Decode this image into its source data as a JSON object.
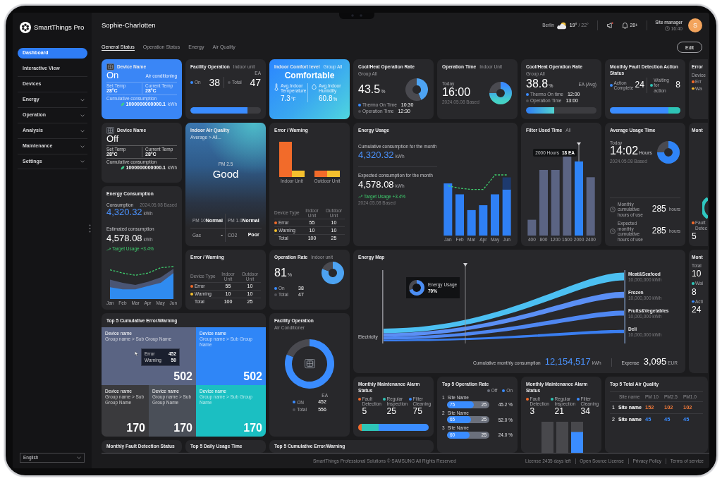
{
  "sidebar": {
    "brand": "SmartThings Pro",
    "items": [
      {
        "label": "Dashboard",
        "selected": true,
        "expandable": false
      },
      {
        "label": "Interactive View",
        "selected": false,
        "expandable": false
      },
      {
        "label": "Devices",
        "selected": false,
        "expandable": false
      },
      {
        "label": "Energy",
        "selected": false,
        "expandable": true
      },
      {
        "label": "Operation",
        "selected": false,
        "expandable": true
      },
      {
        "label": "Analysis",
        "selected": false,
        "expandable": true
      },
      {
        "label": "Maintenance",
        "selected": false,
        "expandable": true
      },
      {
        "label": "Settings",
        "selected": false,
        "expandable": true
      }
    ],
    "language": "English"
  },
  "header": {
    "title": "Sophie-Charlotten",
    "weather": {
      "city": "Berlin",
      "temperature": "19°",
      "range": "/ 22°"
    },
    "notifications": "28+",
    "user": {
      "role": "Site manager",
      "time": "16:40",
      "initial": "S"
    }
  },
  "tabs": [
    {
      "label": "General Status",
      "selected": true
    },
    {
      "label": "Operation Status",
      "selected": false
    },
    {
      "label": "Energy",
      "selected": false
    },
    {
      "label": "Air Quality",
      "selected": false
    }
  ],
  "edit_button": "Edit",
  "cards": [
    {
      "kind": "device",
      "on": true,
      "title": "Device Name",
      "power": "On",
      "mode": "Air conditioning",
      "stats": [
        {
          "label": "Set Temp",
          "value": "28°C"
        },
        {
          "label": "Current Temp",
          "value": "28°C"
        }
      ],
      "consumption_label": "Cumulative consumption",
      "consumption": "1000000000000.1",
      "unit": "kWh"
    },
    {
      "kind": "facility_bar",
      "title": "Facility Operation",
      "subtitle": "Indoor unit",
      "unit": "EA",
      "items": [
        {
          "label": "On",
          "value": "38",
          "color": "#3a8cff"
        },
        {
          "label": "Total",
          "value": "47",
          "color": "#505055"
        }
      ],
      "level": 0.81
    },
    {
      "kind": "comfort",
      "title": "Indoor Comfort level",
      "subtitle": "Group All",
      "status": "Comfortable",
      "metrics": [
        {
          "kind": "temperature",
          "label": "Avg.Indoor Temperature",
          "value": "7.3",
          "unit": "°F"
        },
        {
          "kind": "humidity",
          "label": "Avg.Indoor Humidity",
          "value": "60.8",
          "unit": "%"
        }
      ]
    },
    {
      "kind": "rate_donut",
      "title": "Cool/Heat Operation Rate",
      "subtitle": "Group All",
      "value": "43.5",
      "unit": "%",
      "items": [
        {
          "label": "Thermo On Time",
          "value": "10:30",
          "color": "#3a8cff"
        },
        {
          "label": "Operation Time",
          "value": "12:30",
          "color": "#505055"
        }
      ],
      "chart_data": {
        "type": "donut",
        "values": [
          43.5,
          56.5
        ]
      }
    },
    {
      "kind": "time_donut",
      "title": "Operation Time",
      "subtitle": "Indoor Unit",
      "caption": "Today",
      "value": "16:00",
      "based": "2024.05.08 Based"
    },
    {
      "kind": "rate_bar",
      "title": "Cool/Heat Operation Rate",
      "subtitle": "Group All",
      "note": "EA (Avg)",
      "value": "38.8",
      "unit": "%",
      "items": [
        {
          "label": "Thermo On time",
          "value": "12:00",
          "color": "#3a8cff"
        },
        {
          "label": "Operation Time",
          "value": "13:00",
          "color": "#505055"
        }
      ],
      "level": 0.4
    },
    {
      "kind": "action_status",
      "title": "Monthly Fault Detection Action Status",
      "items": [
        {
          "label": "Action Complete",
          "value": "24",
          "color": "#3a8cff",
          "level": 0.83
        },
        {
          "label": "Waiting for action",
          "value": "8",
          "color": "#2ec4b6",
          "level": 0.17
        }
      ]
    },
    {
      "kind": "clipped",
      "title": "Error",
      "lines": [
        {
          "kind": "label",
          "text": "Device"
        },
        {
          "kind": "label",
          "text": "Err",
          "color": "#f26b2a"
        },
        {
          "kind": "label",
          "text": "Wa",
          "color": "#f5b82e"
        }
      ]
    },
    {
      "kind": "device",
      "on": false,
      "title": "Device Name",
      "power": "Off",
      "stats": [
        {
          "label": "Set Temp",
          "value": "28°C"
        },
        {
          "label": "Current Temp",
          "value": "28°C"
        }
      ],
      "consumption_label": "Cumulative consumption",
      "consumption": "1000000000000.1",
      "unit": "kWh"
    },
    {
      "kind": "air_quality",
      "title": "Indoor Air Quality",
      "subtitle": "Average > All...",
      "metric": "PM 2.5",
      "status": "Good",
      "readings": [
        {
          "label": "PM 10",
          "value": "Normal"
        },
        {
          "label": "PM 1.0",
          "value": "Normal"
        },
        {
          "label": "Gas",
          "value": "-"
        },
        {
          "label": "CO2",
          "value": "Poor"
        }
      ]
    },
    {
      "kind": "error_chart",
      "title": "Error / Warning",
      "chart_labels": [
        "Indoor Unit",
        "Outdoor Unit"
      ],
      "table": {
        "columns": [
          "Device Type",
          "Indoor Unit",
          "Outdoor Unit"
        ],
        "rows": [
          {
            "label": "Error",
            "color": "#f26b2a",
            "values": [
              "55",
              "10"
            ]
          },
          {
            "label": "Warning",
            "color": "#f5c02e",
            "values": [
              "10",
              "10"
            ]
          },
          {
            "label": "Total",
            "values": [
              "100",
              "25"
            ]
          }
        ]
      }
    },
    {
      "kind": "energy_usage",
      "title": "Energy Usage",
      "metrics": [
        {
          "label": "Cumulative consumption for the month",
          "value": "4,320.32",
          "unit": "kWh",
          "highlight": true
        },
        {
          "label": "Expected consumption for the month",
          "value": "4,578.08",
          "unit": "kWh",
          "highlight": false
        }
      ],
      "target": "Target Usage +3.4%",
      "based": "2024.05.08 Based",
      "chart_labels": [
        "Jan",
        "Feb",
        "Mar",
        "Apr",
        "May",
        "Jun"
      ]
    },
    {
      "kind": "filter",
      "title": "Filter Used Time",
      "subtitle": "All",
      "tooltip": [
        "2000 Hours",
        "18 EA"
      ],
      "bars": [
        {
          "label": "400",
          "selected": false
        },
        {
          "label": "800",
          "selected": false
        },
        {
          "label": "1200",
          "selected": false
        },
        {
          "label": "1600",
          "selected": false
        },
        {
          "label": "2000",
          "selected": true
        },
        {
          "label": "2400",
          "selected": false
        }
      ]
    },
    {
      "kind": "usage_time",
      "title": "Average Usage Time",
      "caption": "Today",
      "value": "14:02",
      "unit": "Hours",
      "based": "2024.05.08 Based",
      "rows": [
        {
          "label": "Monthly cumulative hours of use",
          "value": "285",
          "unit": "hours"
        },
        {
          "label": "Expected monthly cumulative hours of use",
          "value": "285",
          "unit": "hours"
        }
      ]
    },
    {
      "kind": "clipped",
      "title": "Mont",
      "lines": [
        {
          "kind": "ring",
          "color": "#2fc7c0"
        },
        {
          "kind": "label",
          "text": "Fault Detec",
          "color": "#f26b2a"
        },
        {
          "kind": "value",
          "text": "5"
        }
      ]
    },
    {
      "kind": "energy_consumption",
      "title": "Energy Consumption",
      "label": "Consumption",
      "based": "2024.05.08 Based",
      "value": "4,320.32",
      "unit": "kWh",
      "estimate_label": "Estimated consumption",
      "estimate": "4,578.08",
      "estimate_unit": "kWh",
      "target": "Target Usage +3.4%",
      "chart_labels": [
        "Jan",
        "Feb",
        "Mar",
        "Apr",
        "May",
        "Jun"
      ]
    },
    {
      "kind": "error_table",
      "title": "Error / Warning",
      "table": {
        "columns": [
          "Device Type",
          "Indoor Unit",
          "Outdoor Unit"
        ],
        "rows": [
          {
            "label": "Error",
            "color": "#f26b2a",
            "values": [
              "55",
              "10"
            ]
          },
          {
            "label": "Warning",
            "color": "#f5c02e",
            "values": [
              "10",
              "10"
            ]
          },
          {
            "label": "Total",
            "values": [
              "100",
              "25"
            ]
          }
        ]
      }
    },
    {
      "kind": "rate_donut",
      "title": "Operation Rate",
      "subtitle": "Indoor unit",
      "value": "81",
      "unit": "%",
      "items": [
        {
          "label": "On",
          "value": "38",
          "color": "#3a8cff"
        },
        {
          "label": "Total",
          "value": "47",
          "color": "#505055"
        }
      ],
      "chart_data": {
        "type": "donut",
        "values": [
          81,
          19
        ]
      }
    },
    {
      "kind": "energy_map",
      "title": "Energy Map",
      "source": "Electricity",
      "tooltip": {
        "label": "Energy Usage",
        "value": "70%"
      },
      "targets": [
        {
          "name": "Meat&Seafood",
          "value": "10,000,000 kWh",
          "color": "#4cc0f2"
        },
        {
          "name": "Frozen",
          "value": "10,000,000 kWh",
          "color": "#5b8ff5"
        },
        {
          "name": "Fruits&Vegetables",
          "value": "10,000,000 kWh",
          "color": "#4f87f2"
        },
        {
          "name": "Deli",
          "value": "10,000,000 kWh",
          "color": "#3a7ef0"
        }
      ],
      "total_label": "Cumulative monthly consumption",
      "total": "12,154,517",
      "total_unit": "kWh",
      "expense_label": "Expense",
      "expense": "3,095",
      "expense_unit": "EUR"
    },
    {
      "kind": "clipped",
      "title": "Mont",
      "lines": [
        {
          "kind": "label",
          "text": "Total"
        },
        {
          "kind": "value",
          "text": "10"
        },
        {
          "kind": "label",
          "text": "Wai",
          "color": "#2ec4b6"
        },
        {
          "kind": "value",
          "text": "8"
        },
        {
          "kind": "label",
          "text": "Acti",
          "color": "#3a8cff"
        },
        {
          "kind": "value",
          "text": "24"
        }
      ]
    },
    {
      "kind": "treemap",
      "title": "Top 5 Cumulative Error/Warning",
      "tiles": [
        {
          "name": "Device name",
          "group": "Group name > Sub Group Name",
          "value": "502",
          "color": "#5a6483"
        },
        {
          "name": "Device name",
          "group": "Group name > Sub Group Name",
          "value": "502",
          "color": "#2f86f7"
        },
        {
          "name": "Device name",
          "group": "Group name > Sub Group Name",
          "value": "170",
          "color": "#3a3a3d"
        },
        {
          "name": "Device name",
          "group": "Group name > Sub Group Name",
          "value": "170",
          "color": "#4a4f58"
        },
        {
          "name": "Device name",
          "group": "Group name > Sub Group Name",
          "value": "170",
          "color": "#1bbfc2"
        }
      ],
      "tooltip": {
        "rows": [
          {
            "label": "Error",
            "value": "452"
          },
          {
            "label": "Warning",
            "value": "50"
          }
        ]
      }
    },
    {
      "kind": "facility_donut",
      "title": "Facility Operation",
      "subtitle": "Air Conditioner",
      "unit": "EA",
      "items": [
        {
          "label": "ON",
          "value": "452",
          "color": "#3a8cff"
        },
        {
          "label": "Total",
          "value": "556",
          "color": "#505055"
        }
      ],
      "chart_data": {
        "type": "donut",
        "values": [
          81.3,
          18.7
        ]
      }
    },
    {
      "kind": "maintenance_bar",
      "title": "Monthly Maintenance Alarm Status",
      "items": [
        {
          "label": "Fault Detection",
          "value": "5",
          "color": "#f26b2a"
        },
        {
          "label": "Regular Inspection",
          "value": "25",
          "color": "#2ec4b6"
        },
        {
          "label": "Filter Cleaning",
          "value": "75",
          "color": "#3a8cff"
        }
      ]
    },
    {
      "kind": "rate_list",
      "title": "Top 5 Operation Rate",
      "legend": [
        {
          "label": "Off",
          "color": "#6b707c"
        },
        {
          "label": "On",
          "color": "#3a8cff"
        }
      ],
      "sites": [
        {
          "rank": "1",
          "name": "Site Name",
          "on": "75",
          "off": "25",
          "rate": "45.2 %",
          "level": 0.64
        },
        {
          "rank": "2",
          "name": "Site Name",
          "on": "65",
          "off": "25",
          "rate": "52.0 %",
          "level": 0.57
        },
        {
          "rank": "3",
          "name": "Site Name",
          "on": "60",
          "off": "25",
          "rate": "24.0 %",
          "level": 0.54
        }
      ]
    },
    {
      "kind": "maintenance_chart",
      "title": "Monthly Maintenance Alarm Status",
      "items": [
        {
          "label": "Fault Detection",
          "value": "3",
          "color": "#f26b2a"
        },
        {
          "label": "Regular Inspection",
          "value": "21",
          "color": "#2ec4b6"
        },
        {
          "label": "Filter Cleaning",
          "value": "34",
          "color": "#3a8cff",
          "level": 0.67
        }
      ]
    },
    {
      "kind": "air_table",
      "title": "Top 5 Total Air Quality",
      "columns": [
        "Site name",
        "PM 10",
        "PM2.5",
        "PM1.0"
      ],
      "rows": [
        {
          "rank": "1",
          "name": "Site name",
          "values": [
            "152",
            "102",
            "102"
          ],
          "color": "#f07a3a"
        },
        {
          "rank": "2",
          "name": "Site name",
          "values": [
            "45",
            "45",
            "45"
          ],
          "color": "#3a8cff"
        }
      ]
    },
    {
      "kind": "title",
      "title": "Monthly Fault Detection Status"
    },
    {
      "kind": "title",
      "title": "Top 5 Daily Usage Time"
    },
    {
      "kind": "title",
      "title": "Top 5 Cumulative Error/Warning"
    }
  ],
  "footer": {
    "copyright": "SmartThings Professional Solutions © SAMSUNG All Rights Reserved",
    "links": [
      "License 2435 days left",
      "Open Source License",
      "Privacy Policy",
      "Terms of service"
    ]
  }
}
